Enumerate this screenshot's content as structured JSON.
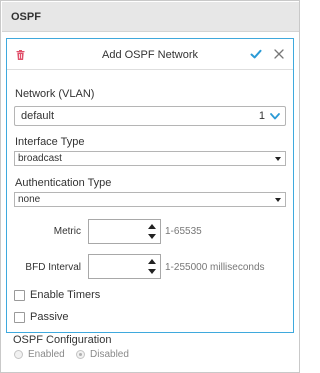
{
  "header": {
    "title": "OSPF"
  },
  "dialog": {
    "title": "Add OSPF Network",
    "icons": {
      "delete": "trash-icon",
      "confirm": "checkmark-icon",
      "close": "close-icon"
    },
    "accent_color": "#2b9bd6",
    "network": {
      "label": "Network (VLAN)",
      "value": "default",
      "count": "1"
    },
    "interface_type": {
      "label": "Interface Type",
      "value": "broadcast"
    },
    "authentication_type": {
      "label": "Authentication Type",
      "value": "none"
    },
    "metric": {
      "label": "Metric",
      "value": "",
      "hint": "1-65535"
    },
    "bfd_interval": {
      "label": "BFD Interval",
      "value": "",
      "hint": "1-255000 milliseconds"
    },
    "enable_timers": {
      "label": "Enable Timers",
      "checked": false
    },
    "passive": {
      "label": "Passive",
      "checked": false
    }
  },
  "ospf_configuration": {
    "title": "OSPF Configuration",
    "options": [
      {
        "label": "Enabled",
        "selected": false
      },
      {
        "label": "Disabled",
        "selected": true
      }
    ]
  }
}
